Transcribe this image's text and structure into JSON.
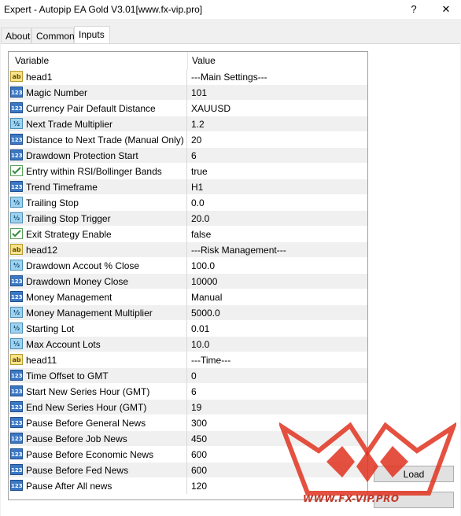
{
  "window": {
    "title": "Expert - Autopip EA Gold V3.01[www.fx-vip.pro]",
    "help_glyph": "?",
    "close_glyph": "✕"
  },
  "tabs": [
    {
      "label": "About"
    },
    {
      "label": "Common"
    },
    {
      "label": "Inputs",
      "active": true
    }
  ],
  "grid": {
    "col_variable": "Variable",
    "col_value": "Value",
    "rows": [
      {
        "type": "ab",
        "type_label": "ab",
        "name": "head1",
        "value": "---Main Settings---"
      },
      {
        "type": "123",
        "type_label": "123",
        "name": "Magic Number",
        "value": "101"
      },
      {
        "type": "123",
        "type_label": "123",
        "name": "Currency Pair Default Distance",
        "value": "XAUUSD"
      },
      {
        "type": "frac",
        "type_label": "½",
        "name": "Next Trade Multiplier",
        "value": "1.2"
      },
      {
        "type": "123",
        "type_label": "123",
        "name": "Distance to Next Trade (Manual Only)",
        "value": "20"
      },
      {
        "type": "123",
        "type_label": "123",
        "name": "Drawdown Protection Start",
        "value": "6"
      },
      {
        "type": "bool",
        "type_label": "",
        "name": "Entry within RSI/Bollinger Bands",
        "value": "true"
      },
      {
        "type": "123",
        "type_label": "123",
        "name": "Trend Timeframe",
        "value": "H1"
      },
      {
        "type": "frac",
        "type_label": "½",
        "name": "Trailing Stop",
        "value": "0.0"
      },
      {
        "type": "frac",
        "type_label": "½",
        "name": "Trailing Stop Trigger",
        "value": "20.0"
      },
      {
        "type": "bool",
        "type_label": "",
        "name": "Exit Strategy Enable",
        "value": "false"
      },
      {
        "type": "ab",
        "type_label": "ab",
        "name": "head12",
        "value": "---Risk Management---"
      },
      {
        "type": "frac",
        "type_label": "½",
        "name": "Drawdown Accout % Close",
        "value": "100.0"
      },
      {
        "type": "123",
        "type_label": "123",
        "name": "Drawdown Money Close",
        "value": "10000"
      },
      {
        "type": "123",
        "type_label": "123",
        "name": "Money Management",
        "value": "Manual"
      },
      {
        "type": "frac",
        "type_label": "½",
        "name": "Money Management Multiplier",
        "value": "5000.0"
      },
      {
        "type": "frac",
        "type_label": "½",
        "name": "Starting Lot",
        "value": "0.01"
      },
      {
        "type": "frac",
        "type_label": "½",
        "name": "Max Account Lots",
        "value": "10.0"
      },
      {
        "type": "ab",
        "type_label": "ab",
        "name": "head11",
        "value": "---Time---"
      },
      {
        "type": "123",
        "type_label": "123",
        "name": "Time Offset to GMT",
        "value": "0"
      },
      {
        "type": "123",
        "type_label": "123",
        "name": "Start New Series Hour (GMT)",
        "value": "6"
      },
      {
        "type": "123",
        "type_label": "123",
        "name": "End New Series Hour (GMT)",
        "value": "19"
      },
      {
        "type": "123",
        "type_label": "123",
        "name": "Pause Before General News",
        "value": "300"
      },
      {
        "type": "123",
        "type_label": "123",
        "name": "Pause Before Job News",
        "value": "450"
      },
      {
        "type": "123",
        "type_label": "123",
        "name": "Pause Before Economic News",
        "value": "600"
      },
      {
        "type": "123",
        "type_label": "123",
        "name": "Pause Before Fed News",
        "value": "600"
      },
      {
        "type": "123",
        "type_label": "123",
        "name": "Pause After All news",
        "value": "120"
      }
    ]
  },
  "buttons": {
    "load": "Load",
    "save": ""
  },
  "watermark": {
    "text": "WWW.FX-VIP.PRO",
    "color": "#e0321e"
  }
}
